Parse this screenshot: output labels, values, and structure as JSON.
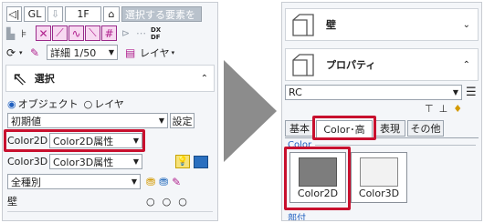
{
  "left": {
    "toolbar1": {
      "gl": "GL",
      "floor": "1F",
      "placeholder": "選択する要素を"
    },
    "dxf_label": "DX\nDF",
    "detail_select": "詳細 1/50",
    "layer_label": "レイヤ",
    "select_header": "選択",
    "radio_object": "オブジェクト",
    "radio_layer": "レイヤ",
    "initial_value": "初期値",
    "setting_button": "設定",
    "color2d_label": "Color2D",
    "color2d_value": "Color2D属性",
    "color3d_label": "Color3D",
    "color3d_value": "Color3D属性",
    "type_select": "全種別",
    "wall_label": "壁"
  },
  "right": {
    "wall_header": "壁",
    "property_header": "プロパティ",
    "rc_select": "RC",
    "tabs": [
      "基本",
      "Color･高",
      "表現",
      "その他"
    ],
    "group_label": "Color",
    "color2d_button": "Color2D",
    "color3d_button": "Color3D",
    "bottom_label": "部付"
  },
  "colors": {
    "highlight": "#c8102e",
    "accent_blue": "#1f5fbf",
    "magenta": "#b01f8d"
  }
}
